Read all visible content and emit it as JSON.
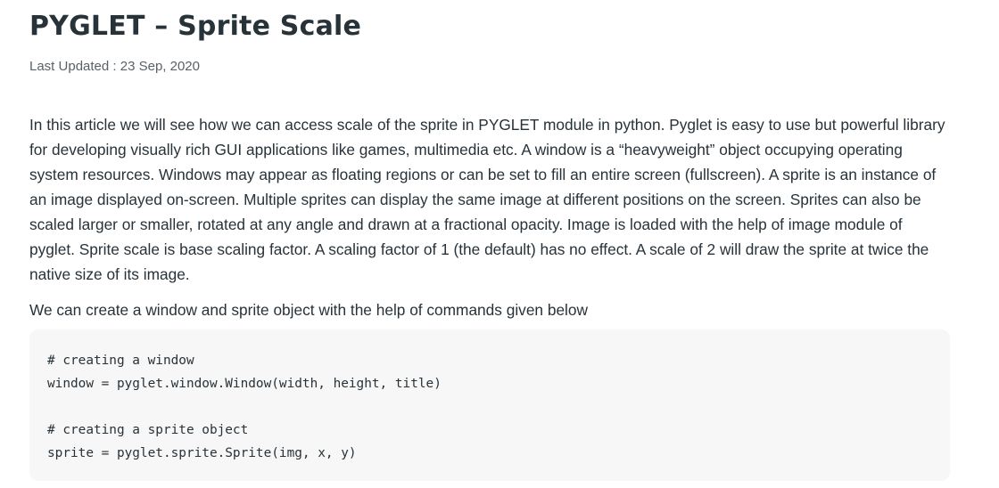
{
  "article": {
    "title": "PYGLET – Sprite Scale",
    "last_updated_label": "Last Updated :",
    "last_updated_date": "23 Sep, 2020",
    "intro": "In this article we will see how we can access scale of the sprite in PYGLET module in python. Pyglet is easy to use but powerful library for developing visually rich GUI applications like games, multimedia etc. A window is a “heavyweight” object occupying operating system resources. Windows may appear as floating regions or can be set to fill an entire screen (fullscreen). A sprite is an instance of an image displayed on-screen. Multiple sprites can display the same image at different positions on the screen. Sprites can also be scaled larger or smaller, rotated at any angle and drawn at a fractional opacity. Image is loaded with the help of image module of pyglet. Sprite scale is base scaling factor. A scaling factor of 1 (the default) has no effect. A scale of 2 will draw the sprite at twice the native size of its image.",
    "lead": "We can create a window and sprite object with the help of commands given below",
    "code": {
      "lines": [
        "# creating a window",
        "window = pyglet.window.Window(width, height, title)",
        "",
        "# creating a sprite object",
        "sprite = pyglet.sprite.Sprite(img, x, y)"
      ]
    }
  },
  "colors": {
    "text": "#273239",
    "meta_text": "#5a6168",
    "code_background": "#f7f7f7"
  }
}
